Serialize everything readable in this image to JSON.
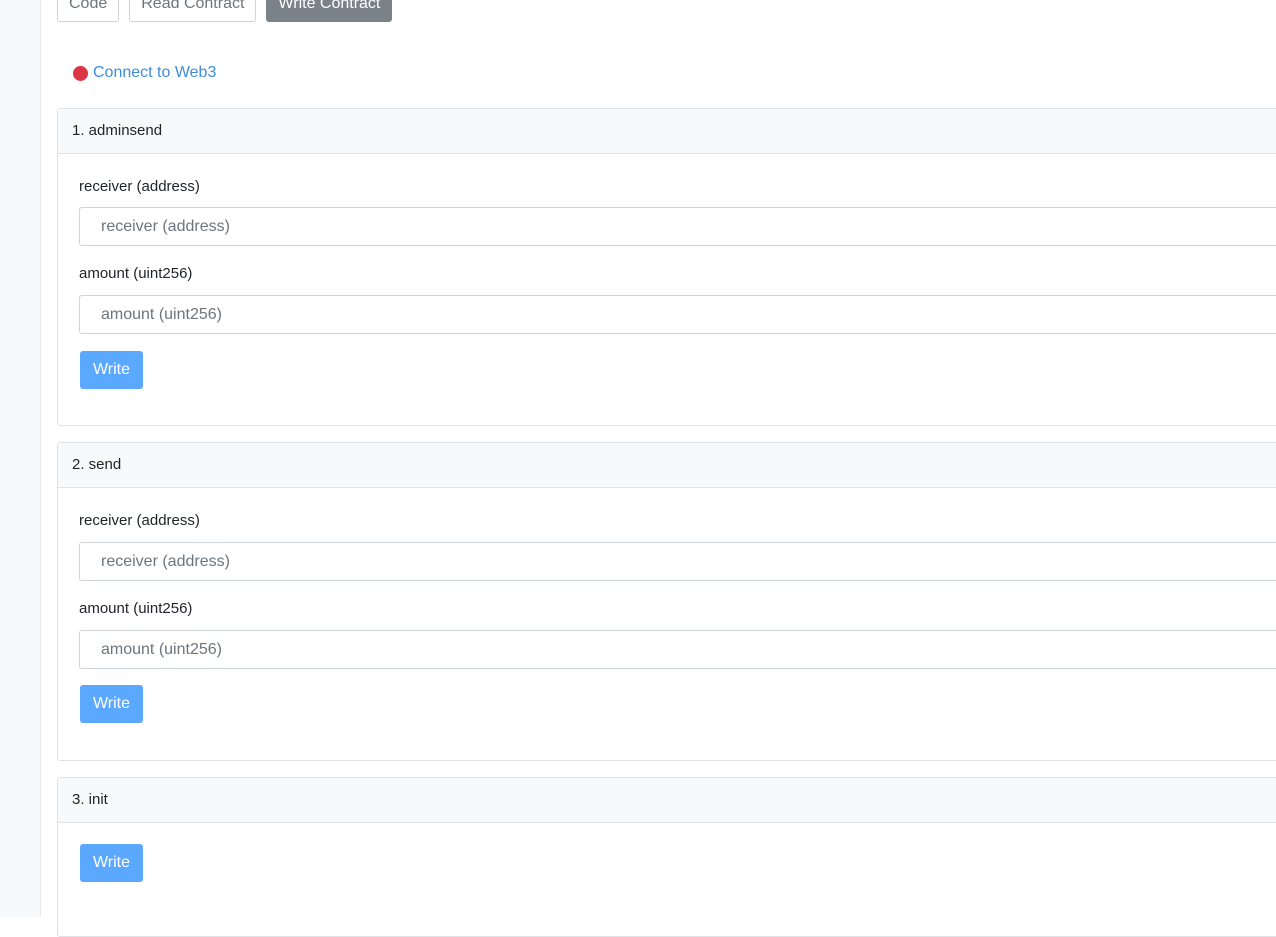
{
  "tabs": [
    {
      "label": "Code",
      "active": false
    },
    {
      "label": "Read Contract",
      "active": false
    },
    {
      "label": "Write Contract",
      "active": true
    }
  ],
  "connect": {
    "label": "Connect to Web3",
    "status_color": "#dc3545"
  },
  "functions": [
    {
      "title": "1. adminsend",
      "inputs": [
        {
          "label": "receiver (address)",
          "placeholder": "receiver (address)",
          "value": ""
        },
        {
          "label": "amount (uint256)",
          "placeholder": "amount (uint256)",
          "value": ""
        }
      ],
      "button_label": "Write"
    },
    {
      "title": "2. send",
      "inputs": [
        {
          "label": "receiver (address)",
          "placeholder": "receiver (address)",
          "value": ""
        },
        {
          "label": "amount (uint256)",
          "placeholder": "amount (uint256)",
          "value": ""
        }
      ],
      "button_label": "Write"
    },
    {
      "title": "3. init",
      "inputs": [],
      "button_label": "Write"
    }
  ],
  "colors": {
    "accent_button": "#5aa8ff",
    "active_tab": "#7b8188",
    "link": "#3f8ed8"
  }
}
